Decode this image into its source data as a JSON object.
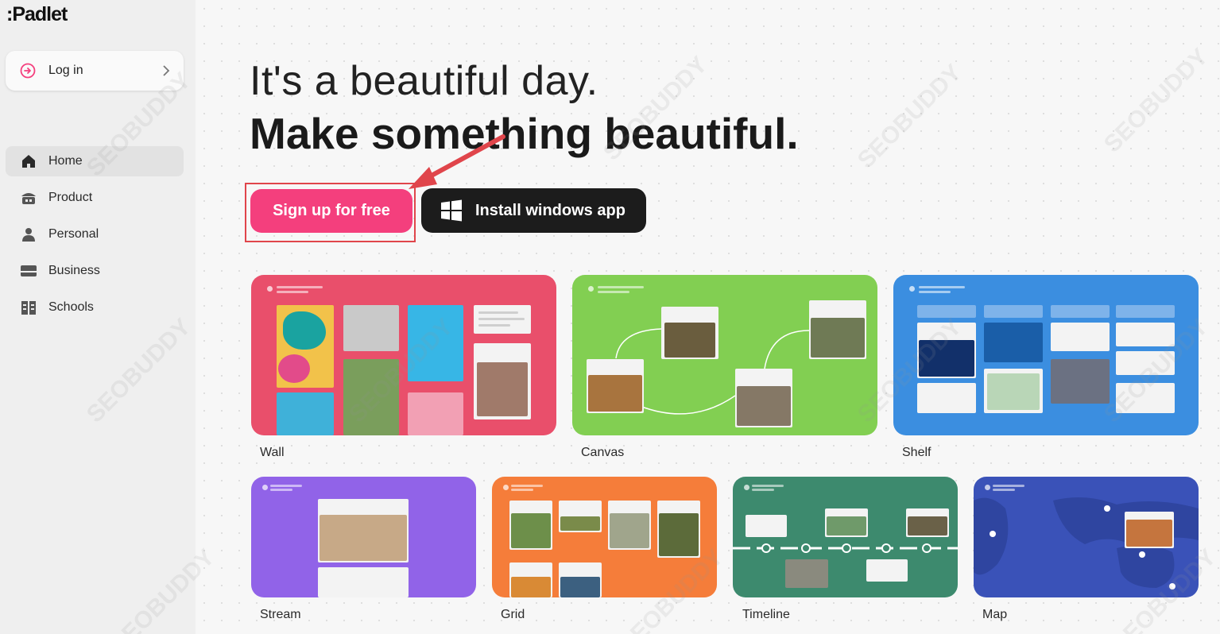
{
  "app": {
    "logo": ":Padlet"
  },
  "sidebar": {
    "login_label": "Log in",
    "items": [
      {
        "label": "Home",
        "icon": "home-icon",
        "active": true
      },
      {
        "label": "Product",
        "icon": "product-icon",
        "active": false
      },
      {
        "label": "Personal",
        "icon": "person-icon",
        "active": false
      },
      {
        "label": "Business",
        "icon": "business-icon",
        "active": false
      },
      {
        "label": "Schools",
        "icon": "schools-icon",
        "active": false
      }
    ]
  },
  "hero": {
    "line1": "It's a beautiful day.",
    "line2": "Make something beautiful.",
    "signup_label": "Sign up for free",
    "install_label": "Install windows app"
  },
  "formats": [
    {
      "label": "Wall",
      "color": "#e94f6b"
    },
    {
      "label": "Canvas",
      "color": "#82cf52"
    },
    {
      "label": "Shelf",
      "color": "#3b8ee0"
    },
    {
      "label": "Stream",
      "color": "#9163e8"
    },
    {
      "label": "Grid",
      "color": "#f57d3a"
    },
    {
      "label": "Timeline",
      "color": "#3d8a6e"
    },
    {
      "label": "Map",
      "color": "#3a52b8"
    }
  ],
  "watermark": "SEOBUDDY",
  "colors": {
    "accent": "#f43f7d",
    "annotation": "#e0454b"
  }
}
